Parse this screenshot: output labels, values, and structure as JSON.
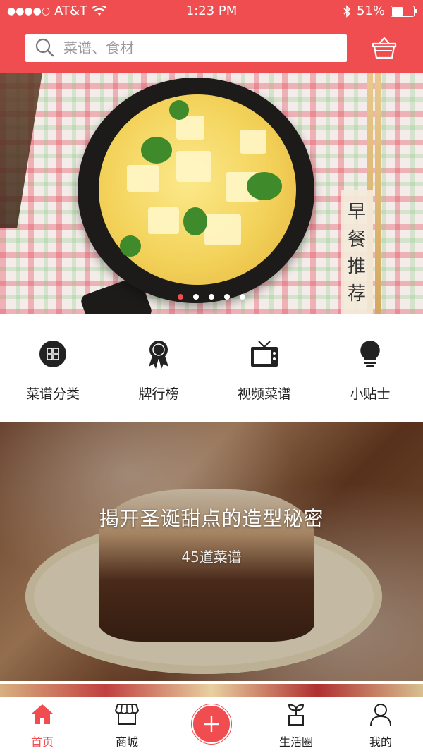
{
  "status_bar": {
    "carrier": "AT&T",
    "time": "1:23 PM",
    "battery_percent": "51%",
    "battery_level": 0.51,
    "signal_dots": "●●●●○"
  },
  "search": {
    "placeholder": "菜谱、食材"
  },
  "banner": {
    "tag_chars": [
      "早",
      "餐",
      "推",
      "荐"
    ],
    "pager_count": 5,
    "active_page": 1
  },
  "quick_nav": [
    {
      "label": "菜谱分类",
      "icon": "grid-icon"
    },
    {
      "label": "牌行榜",
      "icon": "award-ribbon-icon"
    },
    {
      "label": "视频菜谱",
      "icon": "tv-icon"
    },
    {
      "label": "小贴士",
      "icon": "lightbulb-icon"
    }
  ],
  "feature": {
    "title": "揭开圣诞甜点的造型秘密",
    "subtitle": "45道菜谱"
  },
  "tab_bar": [
    {
      "label": "首页",
      "icon": "home-icon",
      "active": true
    },
    {
      "label": "商城",
      "icon": "store-icon",
      "active": false
    },
    {
      "label": "",
      "icon": "plus-icon",
      "active": false
    },
    {
      "label": "生活圈",
      "icon": "sprout-pot-icon",
      "active": false
    },
    {
      "label": "我的",
      "icon": "user-icon",
      "active": false
    }
  ],
  "colors": {
    "brand": "#ef4d4f",
    "text": "#222222",
    "placeholder": "#9a9a9a"
  }
}
